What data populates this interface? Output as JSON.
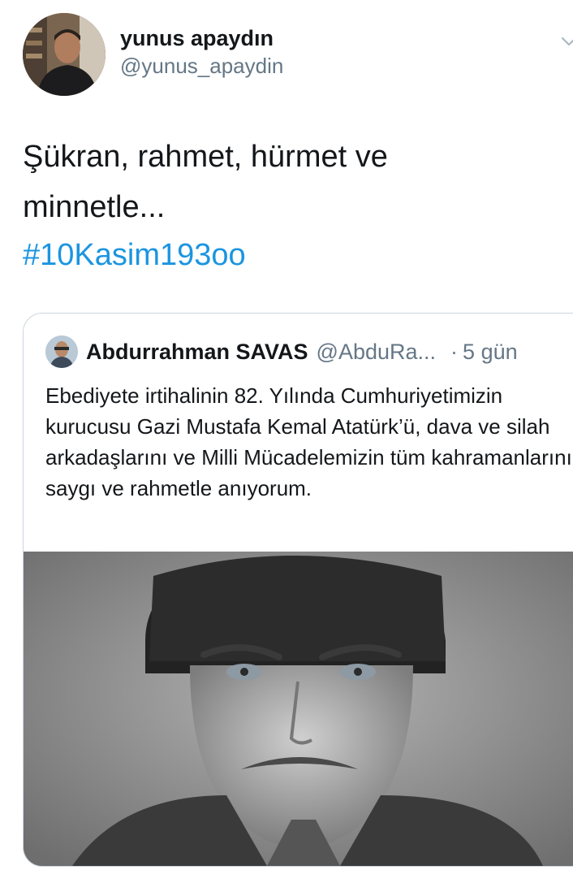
{
  "tweet": {
    "author_name": "yunus apaydın",
    "author_handle": "@yunus_apaydin",
    "text_lines": [
      "Şükran, rahmet, hürmet ve",
      "minnetle..."
    ],
    "hashtag": "#10Kasim193oo"
  },
  "quoted_tweet": {
    "author_name": "Abdurrahman SAVAS",
    "author_handle": "@AbduRa...",
    "separator": "·",
    "time": "5 gün",
    "text": "Ebediyete irtihalinin 82. Yılında Cumhuriyetimizin kurucusu Gazi Mustafa Kemal Atatürk’ü, dava ve silah arkadaşlarını ve Milli Mücadelemizin tüm kahramanlarını saygı ve rahmetle anıyorum."
  },
  "icons": {
    "menu": "chevron-down-icon"
  },
  "colors": {
    "text": "#14171a",
    "secondary": "#657786",
    "link": "#1b95e0",
    "border": "#ccd6dd"
  }
}
